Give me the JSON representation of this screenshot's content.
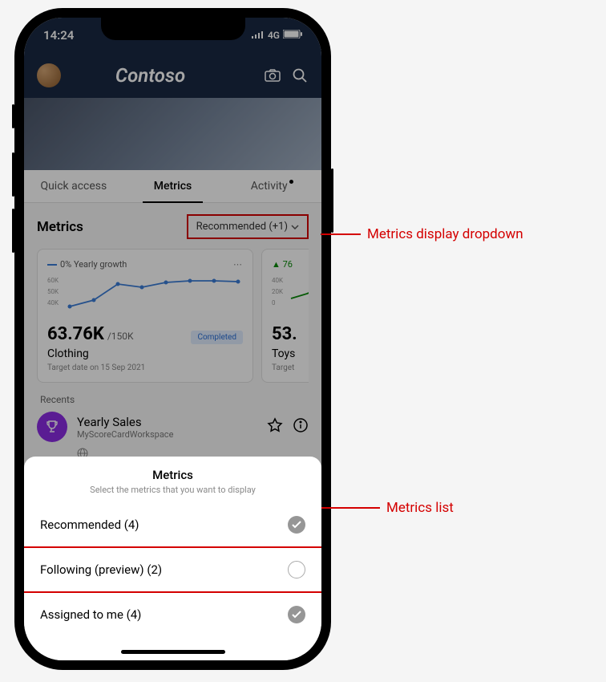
{
  "statusbar": {
    "time": "14:24",
    "network": "4G"
  },
  "header": {
    "brand": "Contoso"
  },
  "tabs": {
    "items": [
      {
        "label": "Quick access"
      },
      {
        "label": "Metrics"
      },
      {
        "label": "Activity"
      }
    ],
    "active_index": 1
  },
  "metrics": {
    "heading": "Metrics",
    "dropdown_label": "Recommended (+1)",
    "cards": [
      {
        "trend_label": "0% Yearly growth",
        "y_ticks": [
          "60K",
          "50K",
          "40K"
        ],
        "value": "63.76K",
        "denominator": "/150K",
        "badge": "Completed",
        "title": "Clothing",
        "target": "Target date on 15 Sep 2021"
      },
      {
        "trend_value": "76",
        "y_ticks": [
          "40K",
          "20K",
          "0"
        ],
        "value": "53.",
        "title": "Toys",
        "target": "Target"
      }
    ],
    "recents_label": "Recents",
    "recents": [
      {
        "title": "Yearly Sales",
        "subtitle": "MyScoreCardWorkspace"
      }
    ]
  },
  "sheet": {
    "title": "Metrics",
    "subtitle": "Select the metrics that you want to display",
    "items": [
      {
        "label": "Recommended (4)",
        "checked": true
      },
      {
        "label": "Following (preview) (2)",
        "checked": false
      },
      {
        "label": "Assigned to me (4)",
        "checked": true
      }
    ]
  },
  "callouts": {
    "dropdown": "Metrics display dropdown",
    "list": "Metrics list"
  },
  "chart_data": {
    "type": "line",
    "title": "0% Yearly growth",
    "ylabel": "",
    "ylim": [
      35000,
      65000
    ],
    "x": [
      0,
      1,
      2,
      3,
      4,
      5,
      6,
      7
    ],
    "values": [
      38000,
      45000,
      58000,
      55000,
      60000,
      62000,
      62000,
      61000
    ]
  }
}
